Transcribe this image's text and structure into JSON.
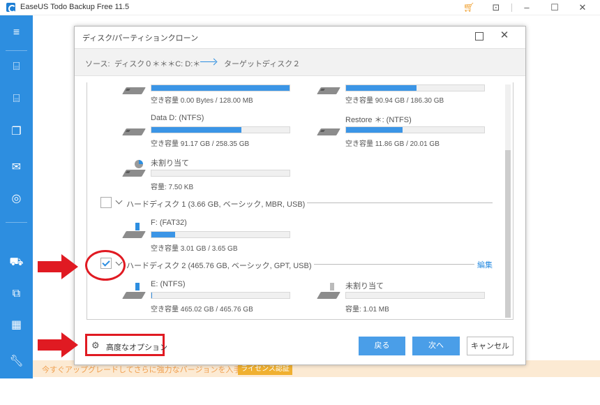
{
  "app": {
    "title": "EaseUS Todo Backup Free 11.5",
    "titlebar_icons": [
      "cart-icon",
      "restore-icon",
      "minimize-icon",
      "maximize-icon",
      "close-icon"
    ]
  },
  "sidebar": {
    "icons": [
      "menu-icon",
      "backup-disk-icon",
      "backup-system-icon",
      "backup-file-icon",
      "backup-mail-icon",
      "smart-backup-icon",
      "cart-icon",
      "clone-icon",
      "windows-icon",
      "tools-icon"
    ]
  },
  "dialog": {
    "title": "ディスク/パーティションクローン",
    "source_label": "ソース:",
    "source_value": "ディスク０＊＊＊C: D:＊",
    "target_label": "ターゲット:",
    "target_value": "ディスク２",
    "partitions_top": [
      {
        "name": "",
        "space": "空き容量 0.00 Bytes / 128.00 MB",
        "fill": 1.0
      },
      {
        "name": "",
        "space": "空き容量 90.94 GB / 186.30 GB",
        "fill": 0.51
      },
      {
        "name": "Data D: (NTFS)",
        "space": "空き容量 91.17 GB / 258.35 GB",
        "fill": 0.65
      },
      {
        "name": "Restore ＊: (NTFS)",
        "space": "空き容量 11.86 GB / 20.01 GB",
        "fill": 0.41
      },
      {
        "name": "未割り当て",
        "space": "容量: 7.50 KB",
        "fill": 0.0
      }
    ],
    "hdd1": {
      "label": "ハードディスク 1 (3.66 GB, ベーシック, MBR, USB)",
      "checked": false,
      "partitions": [
        {
          "name": "F: (FAT32)",
          "space": "空き容量 3.01 GB / 3.65 GB",
          "fill": 0.17
        }
      ]
    },
    "hdd2": {
      "label": "ハードディスク 2 (465.76 GB, ベーシック, GPT, USB)",
      "checked": true,
      "edit_label": "編集",
      "partitions": [
        {
          "name": "E: (NTFS)",
          "space": "空き容量 465.02 GB / 465.76 GB",
          "fill": 0.003
        },
        {
          "name": "未割り当て",
          "space": "容量: 1.01 MB",
          "fill": 0.0
        }
      ]
    },
    "advanced_label": "高度なオプション",
    "back_label": "戻る",
    "next_label": "次へ",
    "cancel_label": "キャンセル"
  },
  "promo": {
    "text": "今すぐアップグレードしてさらに強力なバージョンを入手しましょう。",
    "button": "ライセンス認証"
  },
  "colors": {
    "accent": "#2d8ee0",
    "annotation": "#e01a22",
    "promo_bg": "#fcead3"
  }
}
